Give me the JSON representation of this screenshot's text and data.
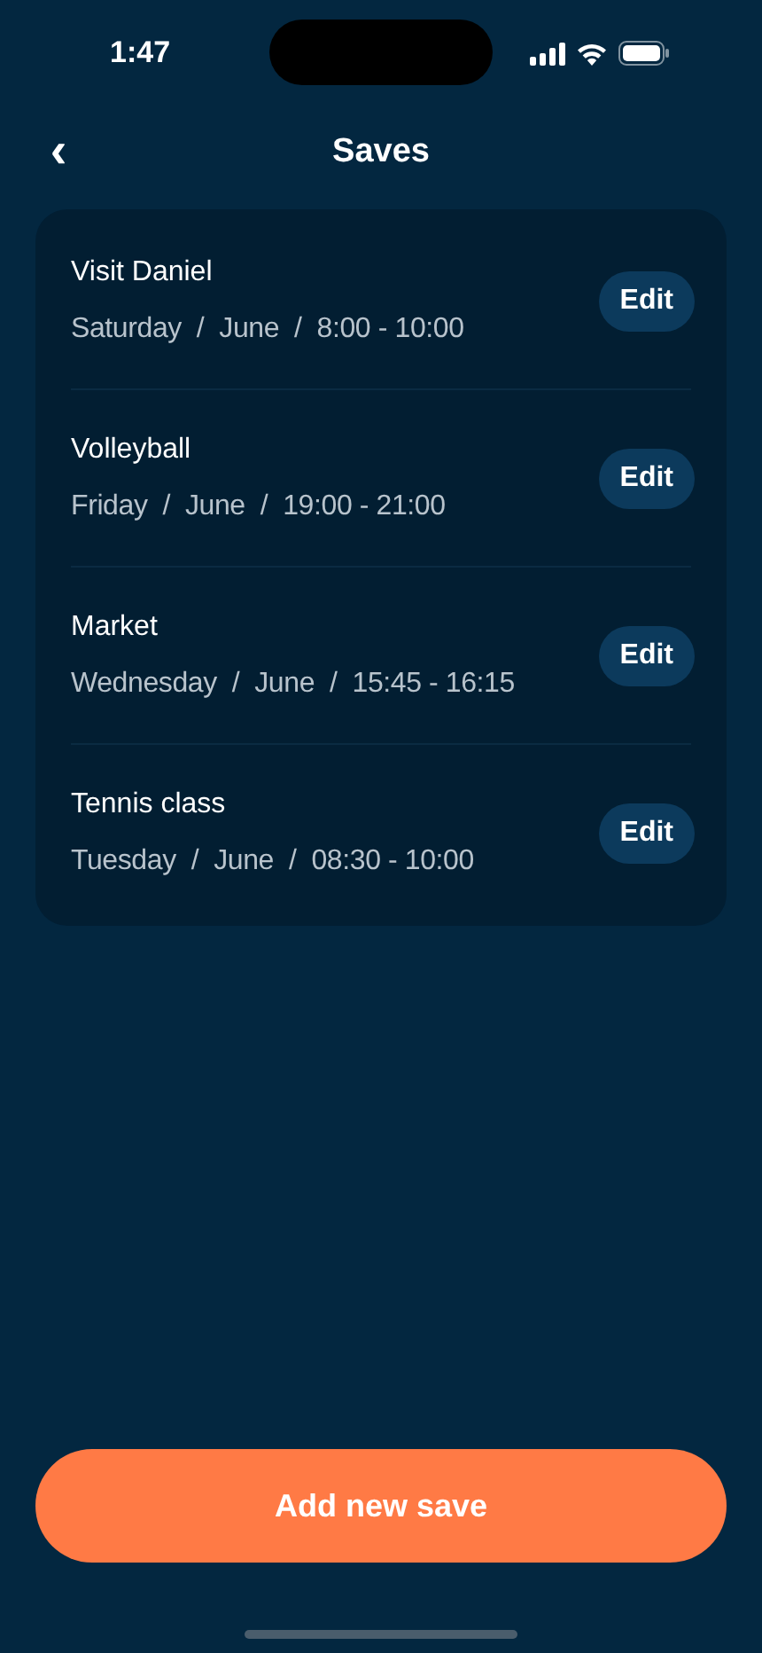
{
  "status_bar": {
    "time": "1:47"
  },
  "header": {
    "back": "‹",
    "title": "Saves"
  },
  "saves": [
    {
      "title": "Visit Daniel",
      "details": "Saturday  /  June  /  8:00 - 10:00",
      "action": "Edit"
    },
    {
      "title": "Volleyball",
      "details": "Friday  /  June  /  19:00 - 21:00",
      "action": "Edit"
    },
    {
      "title": "Market",
      "details": "Wednesday  /  June  /  15:45 - 16:15",
      "action": "Edit"
    },
    {
      "title": "Tennis class",
      "details": "Tuesday  /  June  /  08:30 - 10:00",
      "action": "Edit"
    }
  ],
  "primary_button": "Add new save"
}
